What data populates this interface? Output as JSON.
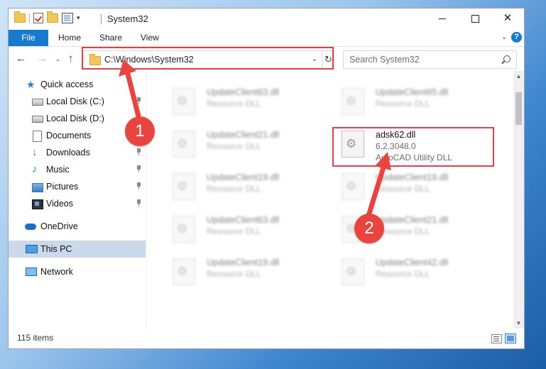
{
  "window": {
    "title": "System32",
    "qat_dropdown_glyph": "▾",
    "controls": {
      "minimize": "",
      "maximize": "",
      "close": "✕"
    }
  },
  "ribbon": {
    "tabs": [
      "File",
      "Home",
      "Share",
      "View"
    ],
    "expand_glyph": "⌄",
    "help_glyph": "?"
  },
  "navbar": {
    "back": "←",
    "forward": "→",
    "recent": "⌄",
    "up": "↑",
    "address": "C:\\Windows\\System32",
    "address_dropdown": "⌄",
    "refresh": "↻",
    "search_placeholder": "Search System32"
  },
  "sidebar": {
    "items": [
      {
        "label": "Quick access",
        "icon": "star-icon",
        "pinned": false
      },
      {
        "label": "Local Disk (C:)",
        "icon": "drive-icon",
        "pinned": true
      },
      {
        "label": "Local Disk (D:)",
        "icon": "drive-icon",
        "pinned": false
      },
      {
        "label": "Documents",
        "icon": "documents-icon",
        "pinned": true
      },
      {
        "label": "Downloads",
        "icon": "downloads-icon",
        "pinned": true
      },
      {
        "label": "Music",
        "icon": "music-icon",
        "pinned": true
      },
      {
        "label": "Pictures",
        "icon": "pictures-icon",
        "pinned": true
      },
      {
        "label": "Videos",
        "icon": "videos-icon",
        "pinned": true
      },
      {
        "label": "OneDrive",
        "icon": "onedrive-icon",
        "pinned": false
      },
      {
        "label": "This PC",
        "icon": "pc-icon",
        "pinned": false,
        "selected": true
      },
      {
        "label": "Network",
        "icon": "network-icon",
        "pinned": false
      }
    ]
  },
  "files": [
    {
      "name": "UpdateClient63.dll",
      "type": "Resource DLL",
      "blurred": true
    },
    {
      "name": "UpdateClient65.dll",
      "type": "Resource DLL",
      "blurred": true
    },
    {
      "name": "UpdateClient21.dll",
      "type": "Resource DLL",
      "blurred": true
    },
    {
      "name": "adsk62.dll",
      "version": "6.2.3048.0",
      "type": "AutoCAD Utility DLL",
      "blurred": false,
      "highlighted": true
    },
    {
      "name": "UpdateClient19.dll",
      "type": "Resource DLL",
      "blurred": true
    },
    {
      "name": "UpdateClient19.dll",
      "type": "Resource DLL",
      "blurred": true
    },
    {
      "name": "UpdateClient63.dll",
      "type": "Resource DLL",
      "blurred": true
    },
    {
      "name": "UpdateClient21.dll",
      "type": "Resource DLL",
      "blurred": true
    },
    {
      "name": "UpdateClient19.dll",
      "type": "Resource DLL",
      "blurred": true
    },
    {
      "name": "UpdateClient42.dll",
      "type": "Resource DLL",
      "blurred": true
    }
  ],
  "status": {
    "item_count": "115 items"
  },
  "annotations": {
    "step1": "1",
    "step2": "2",
    "color": "#e9443f",
    "box_color": "#d9434b"
  },
  "colors": {
    "accent": "#1979ca",
    "selected_bg": "#ccd9ea"
  }
}
